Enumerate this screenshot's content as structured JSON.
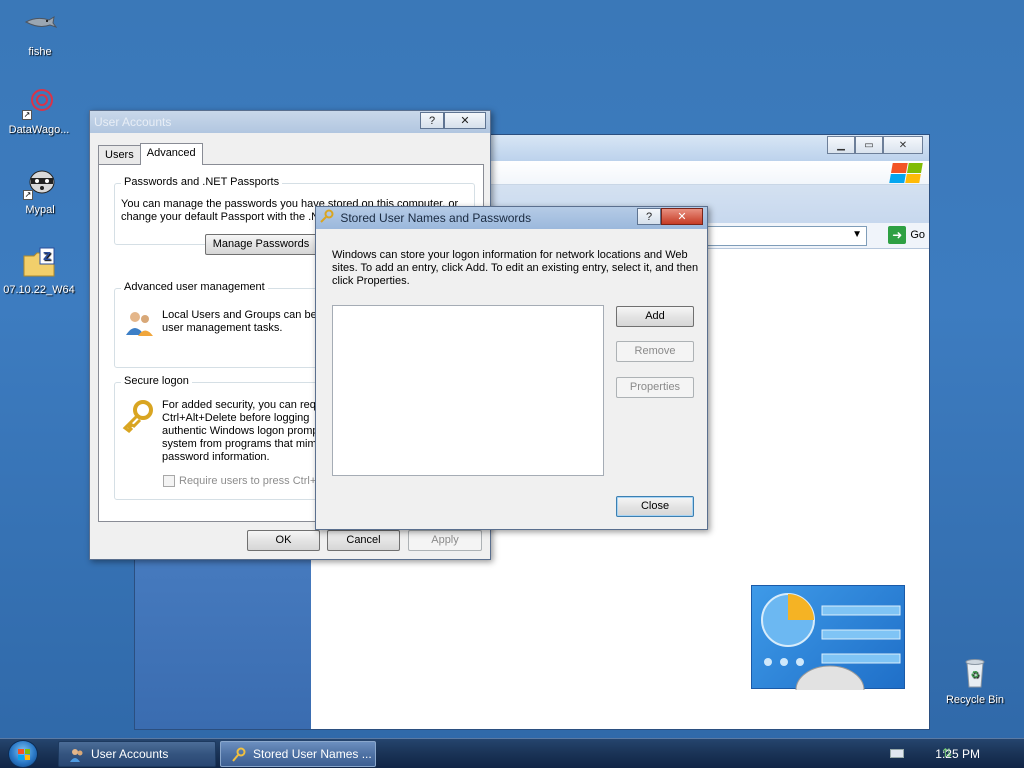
{
  "desktop": {
    "icons": [
      {
        "label": "fishe",
        "icon": "fish-icon"
      },
      {
        "label": "DataWago...",
        "icon": "datawagon-icon"
      },
      {
        "label": "Mypal",
        "icon": "raccoon-icon"
      },
      {
        "label": "07.10.22_W64",
        "icon": "zip-folder-icon"
      },
      {
        "label": "Recycle Bin",
        "icon": "recycle-bin-icon"
      }
    ]
  },
  "explorer": {
    "go_label": "Go"
  },
  "user_accounts": {
    "title": "User Accounts",
    "help_glyph": "?",
    "close_glyph": "✕",
    "tabs": [
      "Users",
      "Advanced"
    ],
    "selected_tab": "Advanced",
    "passwords_group": {
      "title": "Passwords and .NET Passports",
      "text": "You can manage the passwords you have stored on this computer, or\nchange your default Passport with the .N",
      "button": "Manage Passwords"
    },
    "advanced_group": {
      "title": "Advanced user management",
      "text": "Local Users and Groups can be u\nuser management tasks."
    },
    "secure_group": {
      "title": "Secure logon",
      "text": "For added security, you can req\nCtrl+Alt+Delete before logging\nauthentic Windows logon promp\nsystem from programs that mim\npassword information.",
      "checkbox_label": "Require users to press Ctrl+"
    },
    "buttons": {
      "ok": "OK",
      "cancel": "Cancel",
      "apply": "Apply"
    }
  },
  "stored_credentials": {
    "title": "Stored User Names and Passwords",
    "help_glyph": "?",
    "close_glyph": "✕",
    "intro": "Windows can store your logon information for network locations and Web sites. To add an entry, click Add. To edit an existing entry, select it, and then click Properties.",
    "entries": [],
    "buttons": {
      "add": "Add",
      "remove": "Remove",
      "properties": "Properties",
      "close": "Close"
    }
  },
  "taskbar": {
    "items": [
      {
        "label": "User Accounts",
        "active": false,
        "icon": "user-accounts-icon"
      },
      {
        "label": "Stored User Names ...",
        "active": true,
        "icon": "key-icon"
      }
    ],
    "clock": "1:25 PM"
  },
  "colors": {
    "desktop": "#3a78b8",
    "taskbar": "#1a3356",
    "dialog_bg": "#f0f0f0"
  }
}
